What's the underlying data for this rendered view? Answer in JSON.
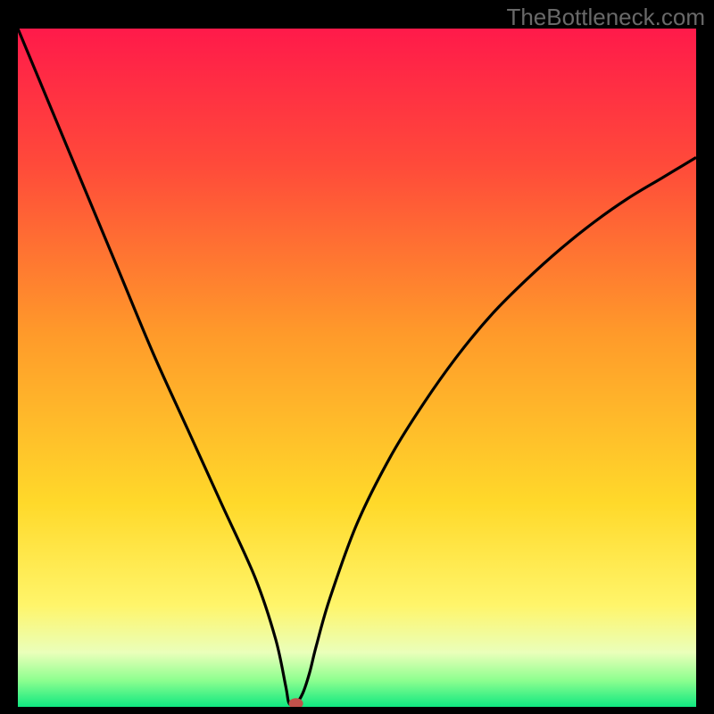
{
  "watermark": "TheBottleneck.com",
  "chart_data": {
    "type": "line",
    "title": "",
    "xlabel": "",
    "ylabel": "",
    "xlim": [
      0,
      100
    ],
    "ylim": [
      0,
      100
    ],
    "series": [
      {
        "name": "curve",
        "x": [
          0,
          5,
          10,
          15,
          20,
          25,
          30,
          35,
          38,
          39.5,
          40,
          41,
          42,
          43,
          44,
          46,
          50,
          55,
          60,
          65,
          70,
          75,
          80,
          85,
          90,
          95,
          100
        ],
        "values": [
          100,
          88,
          76,
          64,
          52,
          41,
          30,
          19,
          10,
          3,
          0.5,
          0.5,
          2,
          5,
          9,
          16,
          27,
          37,
          45,
          52,
          58,
          63,
          67.5,
          71.5,
          75,
          78,
          81
        ]
      }
    ],
    "marker": {
      "x": 41,
      "y": 0.5
    },
    "gradient_stops": [
      {
        "offset": 0.0,
        "color": "#ff1a4a"
      },
      {
        "offset": 0.2,
        "color": "#ff4a3a"
      },
      {
        "offset": 0.45,
        "color": "#ff9a2a"
      },
      {
        "offset": 0.7,
        "color": "#ffd92a"
      },
      {
        "offset": 0.85,
        "color": "#fff56a"
      },
      {
        "offset": 0.92,
        "color": "#eaffba"
      },
      {
        "offset": 0.96,
        "color": "#90ff90"
      },
      {
        "offset": 1.0,
        "color": "#10e880"
      }
    ]
  }
}
